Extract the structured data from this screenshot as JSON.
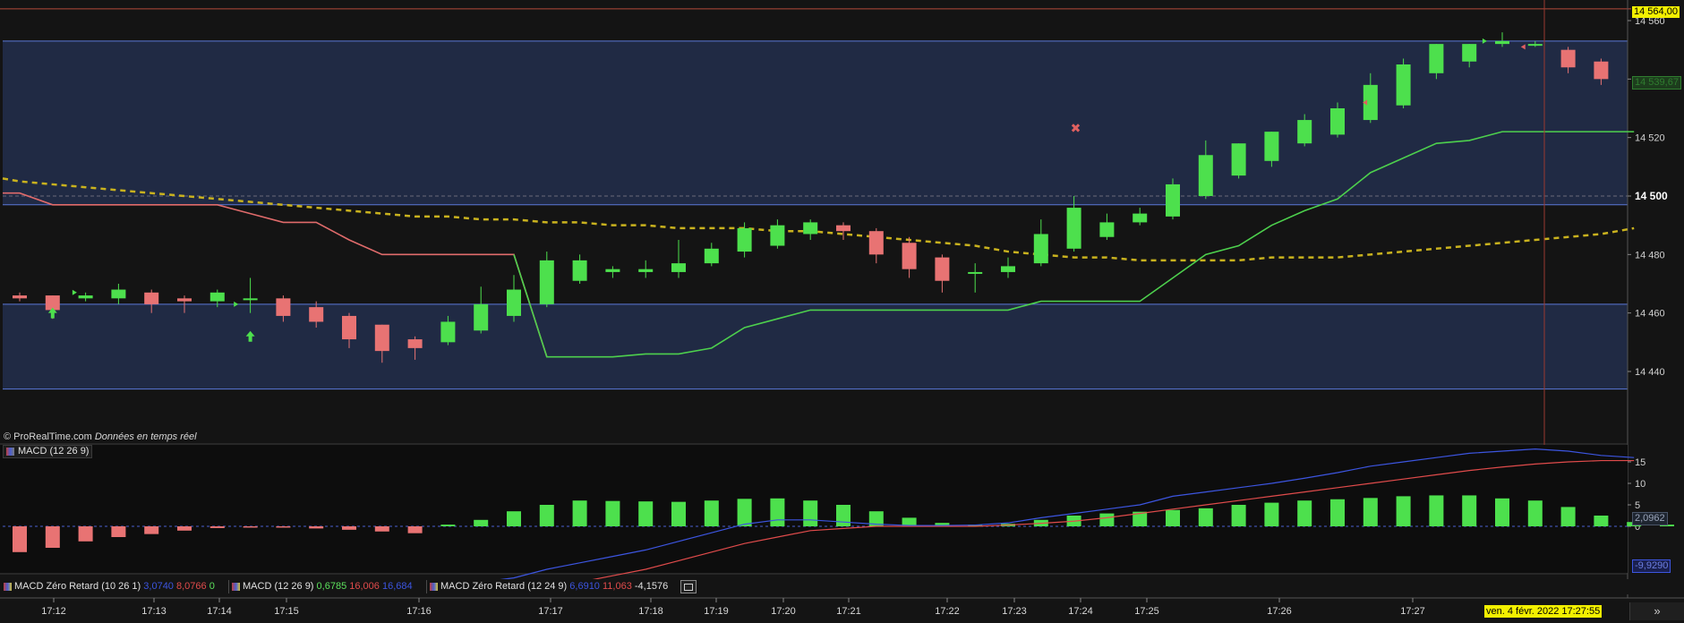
{
  "credit": {
    "source": "© ProRealTime.com",
    "mode": "Données en temps réel"
  },
  "indicator_label": "MACD (12 26 9)",
  "legend": {
    "item1": {
      "name": "MACD Zéro Retard (10 26 1)",
      "v1": "3,0740",
      "v2": "8,0766",
      "v3": "0"
    },
    "item2": {
      "name": "MACD (12 26 9)",
      "v1": "0,6785",
      "v2": "16,006",
      "v3": "16,684"
    },
    "item3": {
      "name": "MACD Zéro Retard (12 24 9)",
      "v1": "6,6910",
      "v2": "11,063",
      "v3": "-4,1576"
    }
  },
  "date_tag": "ven. 4 févr. 2022 17:27:55",
  "scroll_label": "»",
  "price_tags": {
    "top": "14 564,00",
    "last": "14 539,67",
    "macd_a": "2,0962",
    "macd_b": "-9,9290"
  },
  "colors": {
    "up": "#4de04d",
    "down": "#e87373",
    "trail_up": "#4dd04d",
    "trail_down": "#e06b6b",
    "ma": "#c9b21e",
    "macd": "#3c55e0",
    "signal": "#e04b4b",
    "hist": "#4de04d",
    "band": "#202a44"
  },
  "chart_data": [
    {
      "type": "candlestick",
      "title": "",
      "ylim": [
        14425,
        14570
      ],
      "yticks": [
        14440,
        14460,
        14480,
        14500,
        14520,
        14540,
        14560
      ],
      "ytick_labels": [
        "14 440",
        "14 460",
        "14 480",
        "14 500",
        "14 520",
        "14 540",
        "14 560"
      ],
      "highlight_level": 14500,
      "reference_line": 14564,
      "channels": [
        [
          14434,
          14463
        ],
        [
          14497,
          14553
        ]
      ],
      "x_labels": [
        "17:12",
        "17:13",
        "17:14",
        "17:15",
        "17:16",
        "17:17",
        "17:18",
        "17:19",
        "17:20",
        "17:21",
        "17:22",
        "17:23",
        "17:24",
        "17:25",
        "17:26",
        "17:27"
      ],
      "candles": [
        {
          "o": 14466,
          "h": 14467,
          "c": 14465,
          "l": 14464
        },
        {
          "o": 14466,
          "h": 14466,
          "c": 14461,
          "l": 14458
        },
        {
          "o": 14465,
          "h": 14467,
          "c": 14466,
          "l": 14464
        },
        {
          "o": 14465,
          "h": 14470,
          "c": 14468,
          "l": 14463
        },
        {
          "o": 14467,
          "h": 14468,
          "c": 14463,
          "l": 14460
        },
        {
          "o": 14465,
          "h": 14466,
          "c": 14464,
          "l": 14460
        },
        {
          "o": 14464,
          "h": 14468,
          "c": 14467,
          "l": 14462
        },
        {
          "o": 14465,
          "h": 14472,
          "c": 14465,
          "l": 14460
        },
        {
          "o": 14465,
          "h": 14466,
          "c": 14459,
          "l": 14457
        },
        {
          "o": 14462,
          "h": 14464,
          "c": 14457,
          "l": 14455
        },
        {
          "o": 14459,
          "h": 14460,
          "c": 14451,
          "l": 14448
        },
        {
          "o": 14456,
          "h": 14456,
          "c": 14447,
          "l": 14443
        },
        {
          "o": 14451,
          "h": 14452,
          "c": 14448,
          "l": 14444
        },
        {
          "o": 14450,
          "h": 14459,
          "c": 14457,
          "l": 14449
        },
        {
          "o": 14454,
          "h": 14469,
          "c": 14463,
          "l": 14453
        },
        {
          "o": 14459,
          "h": 14473,
          "c": 14468,
          "l": 14457
        },
        {
          "o": 14463,
          "h": 14481,
          "c": 14478,
          "l": 14462
        },
        {
          "o": 14471,
          "h": 14480,
          "c": 14478,
          "l": 14470
        },
        {
          "o": 14474,
          "h": 14476,
          "c": 14475,
          "l": 14472
        },
        {
          "o": 14474,
          "h": 14478,
          "c": 14475,
          "l": 14472
        },
        {
          "o": 14474,
          "h": 14485,
          "c": 14477,
          "l": 14472
        },
        {
          "o": 14477,
          "h": 14484,
          "c": 14482,
          "l": 14476
        },
        {
          "o": 14481,
          "h": 14491,
          "c": 14489,
          "l": 14479
        },
        {
          "o": 14483,
          "h": 14492,
          "c": 14490,
          "l": 14482
        },
        {
          "o": 14487,
          "h": 14492,
          "c": 14491,
          "l": 14485
        },
        {
          "o": 14490,
          "h": 14491,
          "c": 14488,
          "l": 14485
        },
        {
          "o": 14488,
          "h": 14489,
          "c": 14480,
          "l": 14477
        },
        {
          "o": 14484,
          "h": 14486,
          "c": 14475,
          "l": 14472
        },
        {
          "o": 14479,
          "h": 14480,
          "c": 14471,
          "l": 14467
        },
        {
          "o": 14474,
          "h": 14477,
          "c": 14474,
          "l": 14467
        },
        {
          "o": 14474,
          "h": 14479,
          "c": 14476,
          "l": 14472
        },
        {
          "o": 14477,
          "h": 14492,
          "c": 14487,
          "l": 14476
        },
        {
          "o": 14482,
          "h": 14500,
          "c": 14496,
          "l": 14481
        },
        {
          "o": 14486,
          "h": 14494,
          "c": 14491,
          "l": 14485
        },
        {
          "o": 14491,
          "h": 14496,
          "c": 14494,
          "l": 14490
        },
        {
          "o": 14493,
          "h": 14506,
          "c": 14504,
          "l": 14492
        },
        {
          "o": 14500,
          "h": 14519,
          "c": 14514,
          "l": 14499
        },
        {
          "o": 14507,
          "h": 14518,
          "c": 14518,
          "l": 14506
        },
        {
          "o": 14512,
          "h": 14522,
          "c": 14522,
          "l": 14510
        },
        {
          "o": 14518,
          "h": 14528,
          "c": 14526,
          "l": 14517
        },
        {
          "o": 14521,
          "h": 14532,
          "c": 14530,
          "l": 14520
        },
        {
          "o": 14526,
          "h": 14542,
          "c": 14538,
          "l": 14525
        },
        {
          "o": 14531,
          "h": 14547,
          "c": 14545,
          "l": 14530
        },
        {
          "o": 14542,
          "h": 14552,
          "c": 14552,
          "l": 14540
        },
        {
          "o": 14546,
          "h": 14552,
          "c": 14552,
          "l": 14544
        },
        {
          "o": 14552,
          "h": 14556,
          "c": 14553,
          "l": 14551
        },
        {
          "o": 14552,
          "h": 14553,
          "c": 14552,
          "l": 14551
        },
        {
          "o": 14550,
          "h": 14551,
          "c": 14544,
          "l": 14542
        },
        {
          "o": 14546,
          "h": 14547,
          "c": 14540,
          "l": 14538
        }
      ],
      "trailing_stop": [
        14501,
        14501,
        14497,
        14497,
        14497,
        14497,
        14497,
        14497,
        14494,
        14491,
        14491,
        14485,
        14480,
        14480,
        14480,
        14480,
        14480,
        14445,
        14445,
        14445,
        14446,
        14446,
        14448,
        14455,
        14458,
        14461,
        14461,
        14461,
        14461,
        14461,
        14461,
        14461,
        14464,
        14464,
        14464,
        14464,
        14472,
        14480,
        14483,
        14490,
        14495,
        14499,
        14508,
        14513,
        14518,
        14519,
        14522,
        14522,
        14522,
        14522,
        14522
      ],
      "trailing_switch_index": 17,
      "moving_average": [
        14506,
        14505,
        14504,
        14503,
        14502,
        14501,
        14500,
        14499,
        14498,
        14497,
        14496,
        14495,
        14494,
        14493,
        14493,
        14492,
        14492,
        14491,
        14491,
        14490,
        14490,
        14489,
        14489,
        14489,
        14488,
        14488,
        14487,
        14486,
        14485,
        14484,
        14483,
        14481,
        14480,
        14479,
        14479,
        14478,
        14478,
        14478,
        14478,
        14479,
        14479,
        14479,
        14480,
        14481,
        14482,
        14483,
        14484,
        14485,
        14486,
        14487,
        14489
      ]
    },
    {
      "type": "bar",
      "title": "MACD (12 26 9)",
      "ylim": [
        -16,
        18
      ],
      "yticks": [
        0,
        5,
        10,
        15
      ],
      "histogram": [
        -6.0,
        -5.0,
        -3.5,
        -2.5,
        -1.8,
        -1.0,
        -0.4,
        -0.3,
        -0.3,
        -0.5,
        -0.8,
        -1.2,
        -1.6,
        0.4,
        1.5,
        3.5,
        5.0,
        6.0,
        5.9,
        5.8,
        5.7,
        6.0,
        6.4,
        6.5,
        6.0,
        5.0,
        3.5,
        2.0,
        0.8,
        0.4,
        0.6,
        1.5,
        2.5,
        3.0,
        3.4,
        3.8,
        4.2,
        5.0,
        5.5,
        6.0,
        6.3,
        6.6,
        7.0,
        7.2,
        7.2,
        6.5,
        6.0,
        4.5,
        2.5,
        1.0,
        0.4
      ],
      "macd_line": [
        -16,
        -16,
        -16,
        -16,
        -16,
        -16,
        -16,
        -16,
        -16,
        -16,
        -16,
        -16,
        -16,
        -16,
        -16,
        -15,
        -12,
        -10,
        -8.5,
        -7,
        -5.5,
        -3.5,
        -1.5,
        0.5,
        1.5,
        1.5,
        1,
        0.5,
        0.2,
        0.2,
        0.3,
        0.8,
        2,
        3,
        4,
        5,
        7,
        8,
        9,
        10,
        11.2,
        12.5,
        14,
        15,
        16,
        17,
        17.5,
        18,
        17.5,
        16.5,
        16
      ],
      "signal_line": [
        -13,
        -14.5,
        -16,
        -16,
        -16,
        -16,
        -16,
        -16,
        -16,
        -16,
        -16,
        -16,
        -16,
        -16,
        -16,
        -16,
        -16,
        -15,
        -13,
        -11.5,
        -10,
        -8,
        -6,
        -4,
        -2.5,
        -1,
        -0.5,
        0,
        0,
        0,
        0,
        0.3,
        0.7,
        1.2,
        2,
        3,
        4,
        5,
        6,
        7,
        8,
        9,
        10,
        11,
        12,
        13,
        13.8,
        14.5,
        15,
        15.3,
        15.3
      ]
    }
  ]
}
